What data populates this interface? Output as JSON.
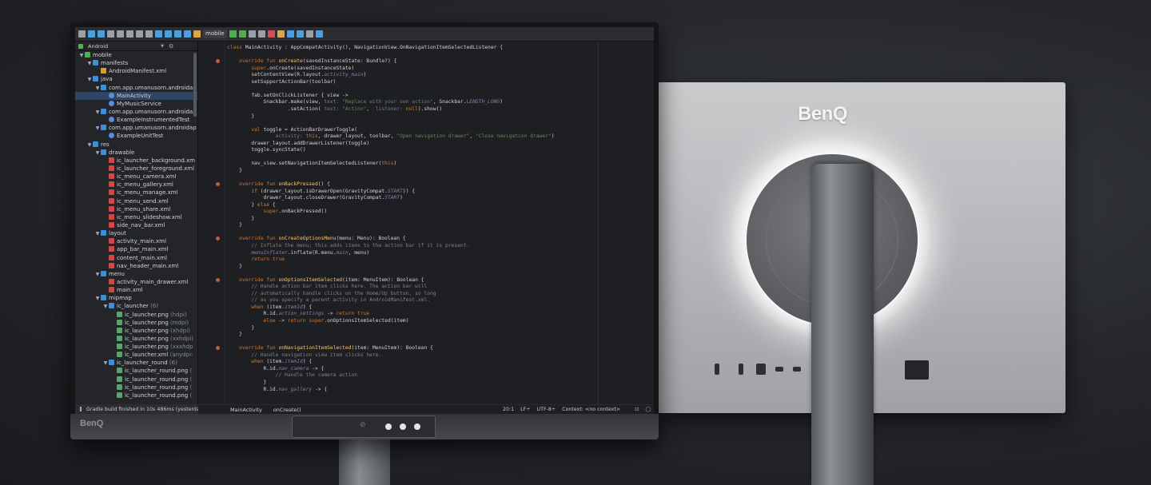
{
  "rear": {
    "logo": "BenQ"
  },
  "front": {
    "logo": "BenQ"
  },
  "toolbar": {
    "run_config": "mobile",
    "icons": [
      "save-icon",
      "sync-icon",
      "refresh-icon",
      "undo-icon",
      "redo-icon",
      "cut-icon",
      "copy-icon",
      "paste-icon",
      "find-icon",
      "replace-icon",
      "back-icon",
      "forward-icon",
      "build-icon",
      "run-icon",
      "debug-icon",
      "profile-icon",
      "attach-icon",
      "stop-icon",
      "sync-gradle-icon",
      "avd-icon",
      "sdk-icon",
      "structure-icon",
      "help-icon"
    ]
  },
  "project": {
    "view_label": "Android",
    "tree": [
      {
        "depth": 0,
        "arrow": "▼",
        "icon": "mod",
        "label": "mobile",
        "suffix": ""
      },
      {
        "depth": 1,
        "arrow": "▼",
        "icon": "folder",
        "label": "manifests",
        "suffix": ""
      },
      {
        "depth": 2,
        "arrow": "",
        "icon": "xml",
        "label": "AndroidManifest.xml",
        "suffix": ""
      },
      {
        "depth": 1,
        "arrow": "▼",
        "icon": "folder",
        "label": "java",
        "suffix": ""
      },
      {
        "depth": 2,
        "arrow": "▼",
        "icon": "folder",
        "label": "com.app.umanusorn.androidap",
        "suffix": ""
      },
      {
        "depth": 3,
        "arrow": "",
        "icon": "kt",
        "label": "MainActivity",
        "suffix": "",
        "selected": true
      },
      {
        "depth": 3,
        "arrow": "",
        "icon": "kt",
        "label": "MyMusicService",
        "suffix": ""
      },
      {
        "depth": 2,
        "arrow": "▼",
        "icon": "folder",
        "label": "com.app.umanusorn.androidap",
        "suffix": ""
      },
      {
        "depth": 3,
        "arrow": "",
        "icon": "kt",
        "label": "ExampleInstrumentedTest",
        "suffix": ""
      },
      {
        "depth": 2,
        "arrow": "▼",
        "icon": "folder",
        "label": "com.app.umanusorn.androidap",
        "suffix": ""
      },
      {
        "depth": 3,
        "arrow": "",
        "icon": "kt",
        "label": "ExampleUnitTest",
        "suffix": ""
      },
      {
        "depth": 1,
        "arrow": "▼",
        "icon": "folder",
        "label": "res",
        "suffix": ""
      },
      {
        "depth": 2,
        "arrow": "▼",
        "icon": "folder",
        "label": "drawable",
        "suffix": ""
      },
      {
        "depth": 3,
        "arrow": "",
        "icon": "res",
        "label": "ic_launcher_background.xm",
        "suffix": ""
      },
      {
        "depth": 3,
        "arrow": "",
        "icon": "res",
        "label": "ic_launcher_foreground.xml",
        "suffix": ""
      },
      {
        "depth": 3,
        "arrow": "",
        "icon": "res",
        "label": "ic_menu_camera.xml",
        "suffix": ""
      },
      {
        "depth": 3,
        "arrow": "",
        "icon": "res",
        "label": "ic_menu_gallery.xml",
        "suffix": ""
      },
      {
        "depth": 3,
        "arrow": "",
        "icon": "res",
        "label": "ic_menu_manage.xml",
        "suffix": ""
      },
      {
        "depth": 3,
        "arrow": "",
        "icon": "res",
        "label": "ic_menu_send.xml",
        "suffix": ""
      },
      {
        "depth": 3,
        "arrow": "",
        "icon": "res",
        "label": "ic_menu_share.xml",
        "suffix": ""
      },
      {
        "depth": 3,
        "arrow": "",
        "icon": "res",
        "label": "ic_menu_slideshow.xml",
        "suffix": ""
      },
      {
        "depth": 3,
        "arrow": "",
        "icon": "res",
        "label": "side_nav_bar.xml",
        "suffix": ""
      },
      {
        "depth": 2,
        "arrow": "▼",
        "icon": "folder",
        "label": "layout",
        "suffix": ""
      },
      {
        "depth": 3,
        "arrow": "",
        "icon": "res",
        "label": "activity_main.xml",
        "suffix": ""
      },
      {
        "depth": 3,
        "arrow": "",
        "icon": "res",
        "label": "app_bar_main.xml",
        "suffix": ""
      },
      {
        "depth": 3,
        "arrow": "",
        "icon": "res",
        "label": "content_main.xml",
        "suffix": ""
      },
      {
        "depth": 3,
        "arrow": "",
        "icon": "res",
        "label": "nav_header_main.xml",
        "suffix": ""
      },
      {
        "depth": 2,
        "arrow": "▼",
        "icon": "folder",
        "label": "menu",
        "suffix": ""
      },
      {
        "depth": 3,
        "arrow": "",
        "icon": "res",
        "label": "activity_main_drawer.xml",
        "suffix": ""
      },
      {
        "depth": 3,
        "arrow": "",
        "icon": "res",
        "label": "main.xml",
        "suffix": ""
      },
      {
        "depth": 2,
        "arrow": "▼",
        "icon": "folder",
        "label": "mipmap",
        "suffix": ""
      },
      {
        "depth": 3,
        "arrow": "▼",
        "icon": "folder",
        "label": "ic_launcher",
        "suffix": " (6)"
      },
      {
        "depth": 4,
        "arrow": "",
        "icon": "png",
        "label": "ic_launcher.png",
        "suffix": " (hdpi)"
      },
      {
        "depth": 4,
        "arrow": "",
        "icon": "png",
        "label": "ic_launcher.png",
        "suffix": " (mdpi)"
      },
      {
        "depth": 4,
        "arrow": "",
        "icon": "png",
        "label": "ic_launcher.png",
        "suffix": " (xhdpi)"
      },
      {
        "depth": 4,
        "arrow": "",
        "icon": "png",
        "label": "ic_launcher.png",
        "suffix": " (xxhdpi)"
      },
      {
        "depth": 4,
        "arrow": "",
        "icon": "png",
        "label": "ic_launcher.png",
        "suffix": " (xxxhdp"
      },
      {
        "depth": 4,
        "arrow": "",
        "icon": "png",
        "label": "ic_launcher.xml",
        "suffix": " (anydpi-"
      },
      {
        "depth": 3,
        "arrow": "▼",
        "icon": "folder",
        "label": "ic_launcher_round",
        "suffix": " (6)"
      },
      {
        "depth": 4,
        "arrow": "",
        "icon": "png",
        "label": "ic_launcher_round.png",
        "suffix": " ("
      },
      {
        "depth": 4,
        "arrow": "",
        "icon": "png",
        "label": "ic_launcher_round.png",
        "suffix": " ("
      },
      {
        "depth": 4,
        "arrow": "",
        "icon": "png",
        "label": "ic_launcher_round.png",
        "suffix": " ("
      },
      {
        "depth": 4,
        "arrow": "",
        "icon": "png",
        "label": "ic_launcher_round.png",
        "suffix": " ("
      }
    ]
  },
  "code_lines": [
    [
      {
        "t": "class ",
        "c": "kw"
      },
      {
        "t": "MainActivity : AppCompatActivity(), NavigationView.OnNavigationItemSelectedListener {"
      }
    ],
    [],
    [
      {
        "t": "    override fun ",
        "c": "kw"
      },
      {
        "t": "onCreate",
        "c": "fn"
      },
      {
        "t": "(savedInstanceState: Bundle?) {"
      }
    ],
    [
      {
        "t": "        "
      },
      {
        "t": "super",
        "c": "kw"
      },
      {
        "t": ".onCreate(savedInstanceState)"
      }
    ],
    [
      {
        "t": "        setContentView(R.layout."
      },
      {
        "t": "activity_main",
        "c": "it"
      },
      {
        "t": ")"
      }
    ],
    [
      {
        "t": "        setSupportActionBar(toolbar)"
      }
    ],
    [],
    [
      {
        "t": "        fab.setOnClickListener { view ->"
      }
    ],
    [
      {
        "t": "            Snackbar.make(view, "
      },
      {
        "t": "text: ",
        "c": "hint"
      },
      {
        "t": "\"Replace with your own action\"",
        "c": "str"
      },
      {
        "t": ", Snackbar."
      },
      {
        "t": "LENGTH_LONG",
        "c": "it"
      },
      {
        "t": ")"
      }
    ],
    [
      {
        "t": "                    .setAction( "
      },
      {
        "t": "text: ",
        "c": "hint"
      },
      {
        "t": "\"Action\"",
        "c": "str"
      },
      {
        "t": ",  "
      },
      {
        "t": "listener: ",
        "c": "hint"
      },
      {
        "t": "null",
        "c": "kw"
      },
      {
        "t": ").show()"
      }
    ],
    [
      {
        "t": "        }"
      }
    ],
    [],
    [
      {
        "t": "        "
      },
      {
        "t": "val ",
        "c": "kw"
      },
      {
        "t": "toggle = ActionBarDrawerToggle("
      }
    ],
    [
      {
        "t": "                "
      },
      {
        "t": "activity: ",
        "c": "hint"
      },
      {
        "t": "this",
        "c": "kw"
      },
      {
        "t": ", drawer_layout, toolbar, "
      },
      {
        "t": "\"Open navigation drawer\"",
        "c": "str"
      },
      {
        "t": ", "
      },
      {
        "t": "\"Close navigation drawer\"",
        "c": "str"
      },
      {
        "t": ")"
      }
    ],
    [
      {
        "t": "        drawer_layout.addDrawerListener(toggle)"
      }
    ],
    [
      {
        "t": "        toggle.syncState()"
      }
    ],
    [],
    [
      {
        "t": "        nav_view.setNavigationItemSelectedListener("
      },
      {
        "t": "this",
        "c": "kw"
      },
      {
        "t": ")"
      }
    ],
    [
      {
        "t": "    }"
      }
    ],
    [],
    [
      {
        "t": "    override fun ",
        "c": "kw"
      },
      {
        "t": "onBackPressed",
        "c": "fn"
      },
      {
        "t": "() {"
      }
    ],
    [
      {
        "t": "        "
      },
      {
        "t": "if ",
        "c": "kw"
      },
      {
        "t": "(drawer_layout.isDrawerOpen(GravityCompat."
      },
      {
        "t": "START",
        "c": "it"
      },
      {
        "t": ")) {"
      }
    ],
    [
      {
        "t": "            drawer_layout.closeDrawer(GravityCompat."
      },
      {
        "t": "START",
        "c": "it"
      },
      {
        "t": ")"
      }
    ],
    [
      {
        "t": "        } "
      },
      {
        "t": "else ",
        "c": "kw"
      },
      {
        "t": "{"
      }
    ],
    [
      {
        "t": "            "
      },
      {
        "t": "super",
        "c": "kw"
      },
      {
        "t": ".onBackPressed()"
      }
    ],
    [
      {
        "t": "        }"
      }
    ],
    [
      {
        "t": "    }"
      }
    ],
    [],
    [
      {
        "t": "    override fun ",
        "c": "kw"
      },
      {
        "t": "onCreateOptionsMenu",
        "c": "fn"
      },
      {
        "t": "(menu: Menu): Boolean {"
      }
    ],
    [
      {
        "t": "        // Inflate the menu; this adds items to the action bar if it is present.",
        "c": "cm"
      }
    ],
    [
      {
        "t": "        "
      },
      {
        "t": "menuInflater",
        "c": "it"
      },
      {
        "t": ".inflate(R.menu."
      },
      {
        "t": "main",
        "c": "it"
      },
      {
        "t": ", menu)"
      }
    ],
    [
      {
        "t": "        "
      },
      {
        "t": "return true",
        "c": "kw"
      }
    ],
    [
      {
        "t": "    }"
      }
    ],
    [],
    [
      {
        "t": "    override fun ",
        "c": "kw"
      },
      {
        "t": "onOptionsItemSelected",
        "c": "fn"
      },
      {
        "t": "(item: MenuItem): Boolean {"
      }
    ],
    [
      {
        "t": "        // Handle action bar item clicks here. The action bar will",
        "c": "cm"
      }
    ],
    [
      {
        "t": "        // automatically handle clicks on the Home/Up button, so long",
        "c": "cm"
      }
    ],
    [
      {
        "t": "        // as you specify a parent activity in AndroidManifest.xml.",
        "c": "cm"
      }
    ],
    [
      {
        "t": "        "
      },
      {
        "t": "when ",
        "c": "kw"
      },
      {
        "t": "(item."
      },
      {
        "t": "itemId",
        "c": "it"
      },
      {
        "t": ") {"
      }
    ],
    [
      {
        "t": "            R.id."
      },
      {
        "t": "action_settings",
        "c": "it"
      },
      {
        "t": " -> "
      },
      {
        "t": "return true",
        "c": "kw"
      }
    ],
    [
      {
        "t": "            "
      },
      {
        "t": "else ",
        "c": "kw"
      },
      {
        "t": "-> "
      },
      {
        "t": "return super",
        "c": "kw"
      },
      {
        "t": ".onOptionsItemSelected(item)"
      }
    ],
    [
      {
        "t": "        }"
      }
    ],
    [
      {
        "t": "    }"
      }
    ],
    [],
    [
      {
        "t": "    override fun ",
        "c": "kw"
      },
      {
        "t": "onNavigationItemSelected",
        "c": "fn"
      },
      {
        "t": "(item: MenuItem): Boolean {"
      }
    ],
    [
      {
        "t": "        // Handle navigation view item clicks here.",
        "c": "cm"
      }
    ],
    [
      {
        "t": "        "
      },
      {
        "t": "when ",
        "c": "kw"
      },
      {
        "t": "(item."
      },
      {
        "t": "itemId",
        "c": "it"
      },
      {
        "t": ") {"
      }
    ],
    [
      {
        "t": "            R.id."
      },
      {
        "t": "nav_camera",
        "c": "it"
      },
      {
        "t": " -> {"
      }
    ],
    [
      {
        "t": "                // Handle the camera action",
        "c": "cm"
      }
    ],
    [
      {
        "t": "            }"
      }
    ],
    [
      {
        "t": "            R.id."
      },
      {
        "t": "nav_gallery",
        "c": "it"
      },
      {
        "t": " -> {"
      }
    ]
  ],
  "breadcrumb": [
    "MainActivity",
    "onCreate()"
  ],
  "status": {
    "message": "Gradle build finished in 10s 486ms (yesterday 21:23)",
    "position": "20:1",
    "line_sep": "LF÷",
    "encoding": "UTF-8÷",
    "context": "Context: <no context>"
  },
  "colors": {
    "keyword": "#cc7832",
    "function": "#ffc66d",
    "string": "#6a8759",
    "comment": "#808080"
  }
}
